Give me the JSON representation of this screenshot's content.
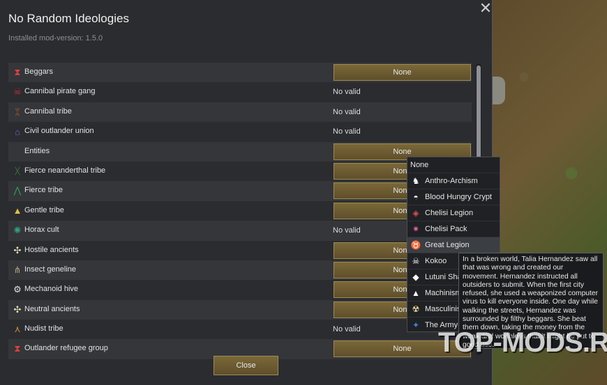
{
  "dialog": {
    "title": "No Random Ideologies",
    "subtitle": "Installed mod-version: 1.5.0",
    "close_x": "✕",
    "close_button": "Close"
  },
  "factions": [
    {
      "name": "Beggars",
      "value": "None",
      "kind": "button",
      "icon": "beggars-icon",
      "glyph": "⧗",
      "color": "#e04040"
    },
    {
      "name": "Cannibal pirate gang",
      "value": "No valid",
      "kind": "text",
      "icon": "skull-icon",
      "glyph": "☠",
      "color": "#c03030"
    },
    {
      "name": "Cannibal tribe",
      "value": "No valid",
      "kind": "text",
      "icon": "tribe-icon",
      "glyph": "ᛯ",
      "color": "#c06020"
    },
    {
      "name": "Civil outlander union",
      "value": "No valid",
      "kind": "text",
      "icon": "house-icon",
      "glyph": "⌂",
      "color": "#7a5cd0"
    },
    {
      "name": "Entities",
      "value": "None",
      "kind": "button",
      "icon": "",
      "glyph": "",
      "color": "#000000"
    },
    {
      "name": "Fierce neanderthal tribe",
      "value": "None",
      "kind": "button",
      "icon": "neanderthal-icon",
      "glyph": "ᚷ",
      "color": "#40b040"
    },
    {
      "name": "Fierce tribe",
      "value": "None",
      "kind": "button",
      "icon": "tribe-icon",
      "glyph": "⋀",
      "color": "#30a050"
    },
    {
      "name": "Gentle tribe",
      "value": "None",
      "kind": "button",
      "icon": "tent-icon",
      "glyph": "▲",
      "color": "#e0c040"
    },
    {
      "name": "Horax cult",
      "value": "No valid",
      "kind": "text",
      "icon": "horax-icon",
      "glyph": "✺",
      "color": "#30a080"
    },
    {
      "name": "Hostile ancients",
      "value": "None",
      "kind": "button",
      "icon": "ancients-icon",
      "glyph": "✣",
      "color": "#e8e0b0"
    },
    {
      "name": "Insect geneline",
      "value": "None",
      "kind": "button",
      "icon": "insect-icon",
      "glyph": "⋔",
      "color": "#b0a080"
    },
    {
      "name": "Mechanoid hive",
      "value": "None",
      "kind": "button",
      "icon": "gear-icon",
      "glyph": "⚙",
      "color": "#e0e0e0"
    },
    {
      "name": "Neutral ancients",
      "value": "None",
      "kind": "button",
      "icon": "ancients-icon",
      "glyph": "✣",
      "color": "#e8e0b0"
    },
    {
      "name": "Nudist tribe",
      "value": "No valid",
      "kind": "text",
      "icon": "nudist-icon",
      "glyph": "⋏",
      "color": "#d09030"
    },
    {
      "name": "Outlander refugee group",
      "value": "None",
      "kind": "button",
      "icon": "refugee-icon",
      "glyph": "⧗",
      "color": "#e04040"
    }
  ],
  "dropdown": {
    "items": [
      {
        "label": "None",
        "icon": "",
        "glyph": "",
        "color": "#ffffff"
      },
      {
        "label": "Anthro-Archism",
        "icon": "anthro-icon",
        "glyph": "♞",
        "color": "#ffffff"
      },
      {
        "label": "Blood Hungry Crypt",
        "icon": "crypt-icon",
        "glyph": "◓",
        "color": "#ffffff"
      },
      {
        "label": "Chelisi Legion",
        "icon": "chelisi-legion-icon",
        "glyph": "◈",
        "color": "#e05050"
      },
      {
        "label": "Chelisi Pack",
        "icon": "chelisi-pack-icon",
        "glyph": "✷",
        "color": "#e060a0"
      },
      {
        "label": "Great Legion",
        "icon": "great-legion-icon",
        "glyph": "♉",
        "color": "#e07080"
      },
      {
        "label": "Kokoo",
        "icon": "skull-icon",
        "glyph": "☠",
        "color": "#ffffff"
      },
      {
        "label": "Lutuni Sha",
        "icon": "lutuni-icon",
        "glyph": "◆",
        "color": "#ffffff"
      },
      {
        "label": "Machinism",
        "icon": "machinism-icon",
        "glyph": "▲",
        "color": "#ffffff"
      },
      {
        "label": "Masculinis",
        "icon": "masculinis-icon",
        "glyph": "☢",
        "color": "#f0e0a0"
      },
      {
        "label": "The Army",
        "icon": "army-icon",
        "glyph": "✦",
        "color": "#4080e0"
      }
    ],
    "highlighted": 5
  },
  "tooltip": {
    "text": "In a broken world, Talia Hernandez saw all that was wrong and created our movement. Hernandez instructed all outsiders to submit. When the first city refused, she used a weaponized computer virus to kill everyone inside. One day while walking the streets, Hernandez was surrounded by filthy beggars. She beat them down, taking the money from the weak and worthless that it might be put to good use."
  },
  "watermark": "TOP-MODS.RU"
}
